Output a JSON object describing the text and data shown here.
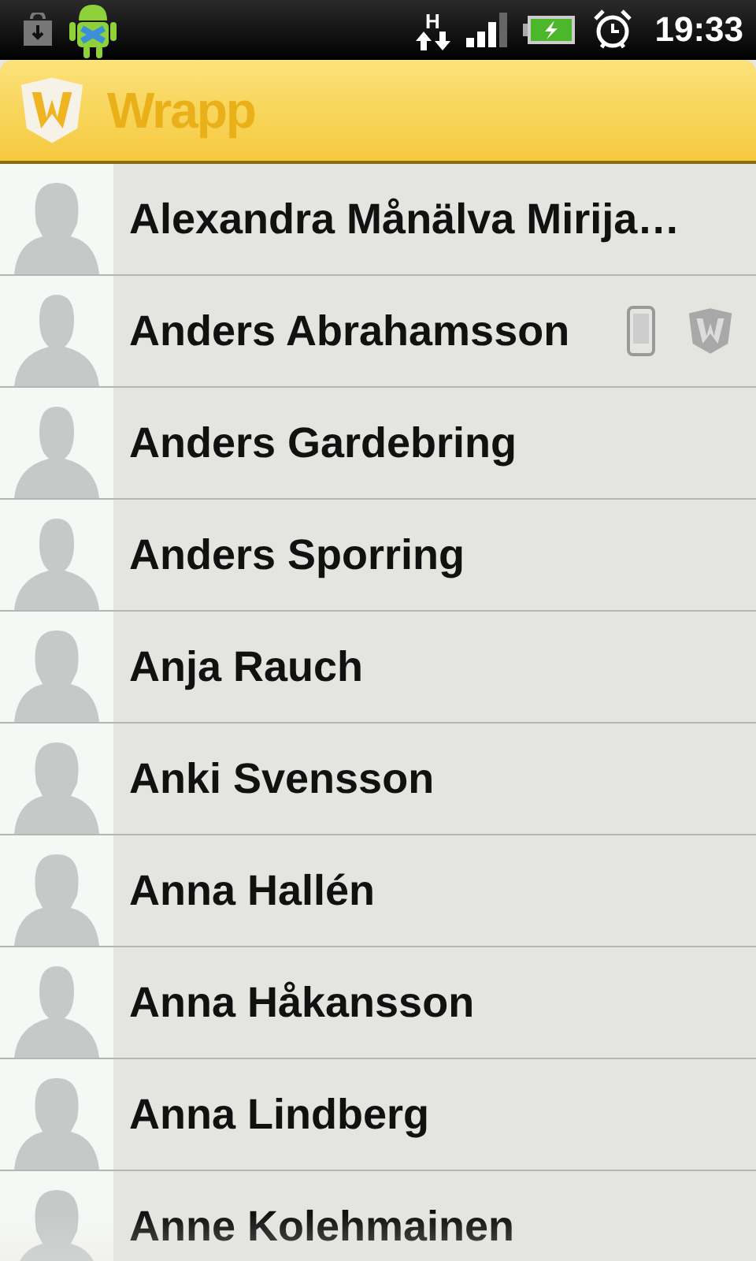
{
  "status_bar": {
    "network": "H",
    "time": "19:33"
  },
  "header": {
    "title": "Wrapp"
  },
  "contacts": [
    {
      "name": "Alexandra Månälva Mirija…",
      "kind": "female",
      "phone": false,
      "wrapp": false
    },
    {
      "name": "Anders Abrahamsson",
      "kind": "male",
      "phone": true,
      "wrapp": true
    },
    {
      "name": "Anders Gardebring",
      "kind": "male",
      "phone": false,
      "wrapp": false
    },
    {
      "name": "Anders Sporring",
      "kind": "male",
      "phone": false,
      "wrapp": false
    },
    {
      "name": "Anja Rauch",
      "kind": "female",
      "phone": false,
      "wrapp": false
    },
    {
      "name": "Anki Svensson",
      "kind": "female",
      "phone": false,
      "wrapp": false
    },
    {
      "name": "Anna Hallén",
      "kind": "female",
      "phone": false,
      "wrapp": false
    },
    {
      "name": "Anna Håkansson",
      "kind": "male",
      "phone": false,
      "wrapp": false
    },
    {
      "name": "Anna Lindberg",
      "kind": "female",
      "phone": false,
      "wrapp": false
    },
    {
      "name": "Anne Kolehmainen",
      "kind": "female",
      "phone": false,
      "wrapp": false
    }
  ]
}
